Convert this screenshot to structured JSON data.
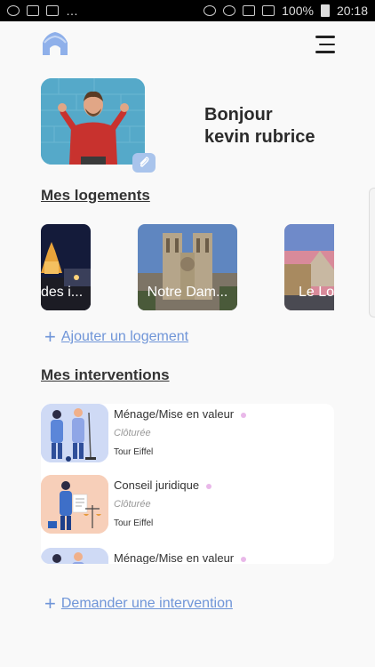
{
  "status_bar": {
    "battery": "100%",
    "time": "20:18"
  },
  "header": {
    "logo_icon": "house-logo-icon",
    "menu_icon": "hamburger-menu-icon"
  },
  "profile": {
    "greeting_line1": "Bonjour",
    "greeting_line2": "kevin rubrice",
    "edit_icon": "paperclip-edit-icon"
  },
  "logements": {
    "title": "Mes logements",
    "items": [
      {
        "label": "des i..."
      },
      {
        "label": "Notre Dam..."
      },
      {
        "label": "Le Lo"
      }
    ],
    "add_label": "Ajouter un logement"
  },
  "interventions": {
    "title": "Mes interventions",
    "items": [
      {
        "title": "Ménage/Mise en valeur",
        "status": "Clôturée",
        "place": "Tour Eiffel"
      },
      {
        "title": "Conseil juridique",
        "status": "Clôturée",
        "place": "Tour Eiffel"
      },
      {
        "title": "Ménage/Mise en valeur",
        "status": "",
        "place": ""
      }
    ],
    "request_label": "Demander une intervention"
  },
  "colors": {
    "accent": "#6f95d8",
    "status_dot": "#e9b8e9"
  }
}
